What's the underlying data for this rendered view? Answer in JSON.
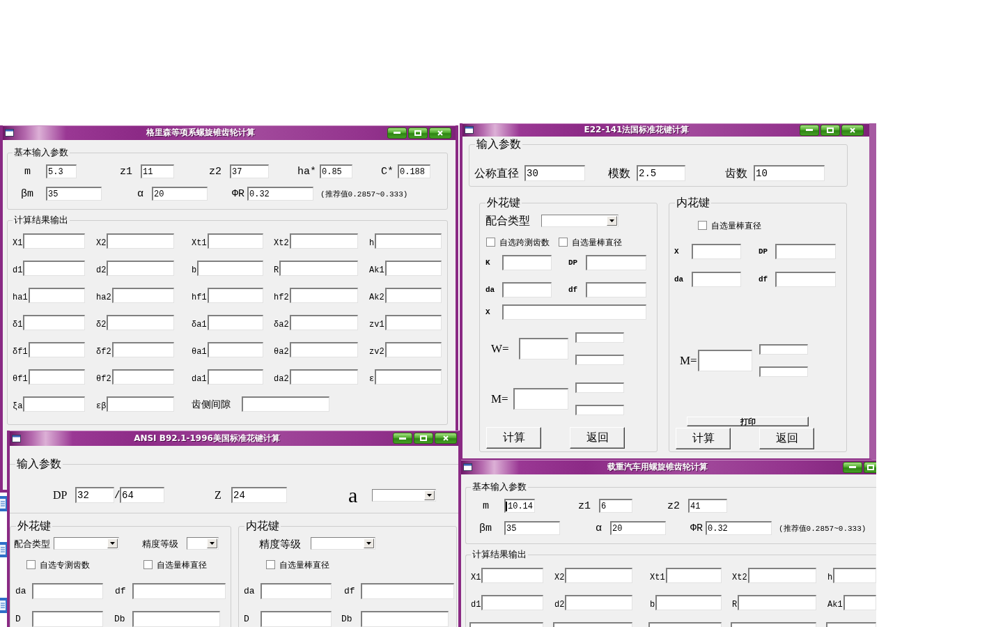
{
  "windows": [
    {
      "kind": "bevel",
      "title": "格里森等项系螺旋锥齿轮计算",
      "input_group": {
        "title": "基本输入参数",
        "rows": [
          [
            {
              "label": "m",
              "value": "5.3"
            },
            {
              "label": "z1",
              "value": "11"
            },
            {
              "label": "z2",
              "value": "37"
            },
            {
              "label": "ha*",
              "value": "0.85"
            },
            {
              "label": "C*",
              "value": "0.188"
            }
          ],
          [
            {
              "label": "βm",
              "value": "35"
            },
            {
              "label": "α",
              "value": "20"
            },
            {
              "label": "ΦR",
              "value": "0.32"
            }
          ]
        ],
        "note": "(推荐值0.2857~0.333)"
      },
      "output_group": {
        "title": "计算结果输出",
        "rows": [
          [
            {
              "label": "X1"
            },
            {
              "label": "X2"
            },
            {
              "label": "Xt1"
            },
            {
              "label": "Xt2"
            },
            {
              "label": "h"
            }
          ],
          [
            {
              "label": "d1"
            },
            {
              "label": "d2"
            },
            {
              "label": "b"
            },
            {
              "label": "R"
            },
            {
              "label": "Ak1"
            }
          ],
          [
            {
              "label": "ha1"
            },
            {
              "label": "ha2"
            },
            {
              "label": "hf1"
            },
            {
              "label": "hf2"
            },
            {
              "label": "Ak2"
            }
          ],
          [
            {
              "label": "δ1"
            },
            {
              "label": "δ2"
            },
            {
              "label": "δa1"
            },
            {
              "label": "δa2"
            },
            {
              "label": "zv1"
            }
          ],
          [
            {
              "label": "δf1"
            },
            {
              "label": "δf2"
            },
            {
              "label": "θa1"
            },
            {
              "label": "θa2"
            },
            {
              "label": "zv2"
            }
          ],
          [
            {
              "label": "θf1"
            },
            {
              "label": "θf2"
            },
            {
              "label": "da1"
            },
            {
              "label": "da2"
            },
            {
              "label": "ε"
            }
          ],
          [
            {
              "label": "ξa"
            },
            {
              "label": "εβ"
            },
            {
              "label": "齿侧间隙"
            }
          ]
        ]
      }
    },
    {
      "kind": "spline_fr",
      "title": "E22-141法国标准花键计算",
      "input_group": {
        "title": "输入参数",
        "fields": [
          {
            "label": "公称直径",
            "value": "30"
          },
          {
            "label": "模数",
            "value": "2.5"
          },
          {
            "label": "齿数",
            "value": "10"
          }
        ]
      },
      "external": {
        "title": "外花键",
        "select": {
          "label": "配合类型"
        },
        "checkboxes": [
          {
            "label": "自选跨测齿数",
            "checked": false
          },
          {
            "label": "自选量棒直径",
            "checked": false
          }
        ],
        "field_rows": [
          [
            {
              "label": "K"
            },
            {
              "label": "DP"
            }
          ],
          [
            {
              "label": "da"
            },
            {
              "label": "df"
            }
          ],
          [
            {
              "label": "X"
            }
          ]
        ],
        "measures": [
          {
            "label": "W="
          },
          {
            "label": "M="
          }
        ],
        "buttons": [
          "计算",
          "返回"
        ]
      },
      "internal": {
        "title": "内花键",
        "checkboxes": [
          {
            "label": "自选量棒直径",
            "checked": false
          }
        ],
        "field_rows": [
          [
            {
              "label": "X"
            },
            {
              "label": "DP"
            }
          ],
          [
            {
              "label": "da"
            },
            {
              "label": "df"
            }
          ]
        ],
        "measures": [
          {
            "label": "M="
          }
        ],
        "print_button": "打印",
        "buttons": [
          "计算",
          "返回"
        ]
      }
    },
    {
      "kind": "spline_ansi",
      "title": "ANSI B92.1-1996美国标准花键计算",
      "input_group": {
        "title": "输入参数",
        "dp": {
          "label": "DP",
          "values": [
            "32",
            "64"
          ],
          "separator": "/"
        },
        "z": {
          "label": "Z",
          "value": "24"
        },
        "angle": {
          "label": "a"
        }
      },
      "external": {
        "title": "外花键",
        "selects": [
          {
            "label": "配合类型"
          },
          {
            "label": "精度等级"
          }
        ],
        "checkboxes": [
          {
            "label": "自选专测齿数",
            "checked": false
          },
          {
            "label": "自选量棒直径",
            "checked": false
          }
        ],
        "field_rows": [
          [
            {
              "label": "da"
            },
            {
              "label": "df"
            }
          ],
          [
            {
              "label": "D"
            },
            {
              "label": "Db"
            }
          ]
        ]
      },
      "internal": {
        "title": "内花键",
        "selects": [
          {
            "label": "精度等级"
          }
        ],
        "checkboxes": [
          {
            "label": "自选量棒直径",
            "checked": false
          }
        ],
        "field_rows": [
          [
            {
              "label": "da"
            },
            {
              "label": "df"
            }
          ],
          [
            {
              "label": "D"
            },
            {
              "label": "Db"
            }
          ]
        ]
      }
    },
    {
      "kind": "bevel",
      "title": "载重汽车用螺旋锥齿轮计算",
      "input_group": {
        "title": "基本输入参数",
        "rows": [
          [
            {
              "label": "m",
              "value": "10.14",
              "focused": true
            },
            {
              "label": "z1",
              "value": "6",
              "focused": false
            },
            {
              "label": "z2",
              "value": "41",
              "focused": false
            }
          ],
          [
            {
              "label": "βm",
              "value": "35",
              "focused": false
            },
            {
              "label": "α",
              "value": "20",
              "focused": false
            },
            {
              "label": "ΦR",
              "value": "0.32",
              "focused": false
            }
          ]
        ],
        "note": "(推荐值0.2857~0.333)"
      },
      "output_group": {
        "title": "计算结果输出",
        "rows": [
          [
            {
              "label": "X1"
            },
            {
              "label": "X2"
            },
            {
              "label": "Xt1"
            },
            {
              "label": "Xt2"
            },
            {
              "label": "h"
            }
          ],
          [
            {
              "label": "d1"
            },
            {
              "label": "d2"
            },
            {
              "label": "b"
            },
            {
              "label": "R"
            },
            {
              "label": "Ak1"
            }
          ],
          [
            {},
            {},
            {},
            {},
            {}
          ]
        ]
      }
    }
  ]
}
